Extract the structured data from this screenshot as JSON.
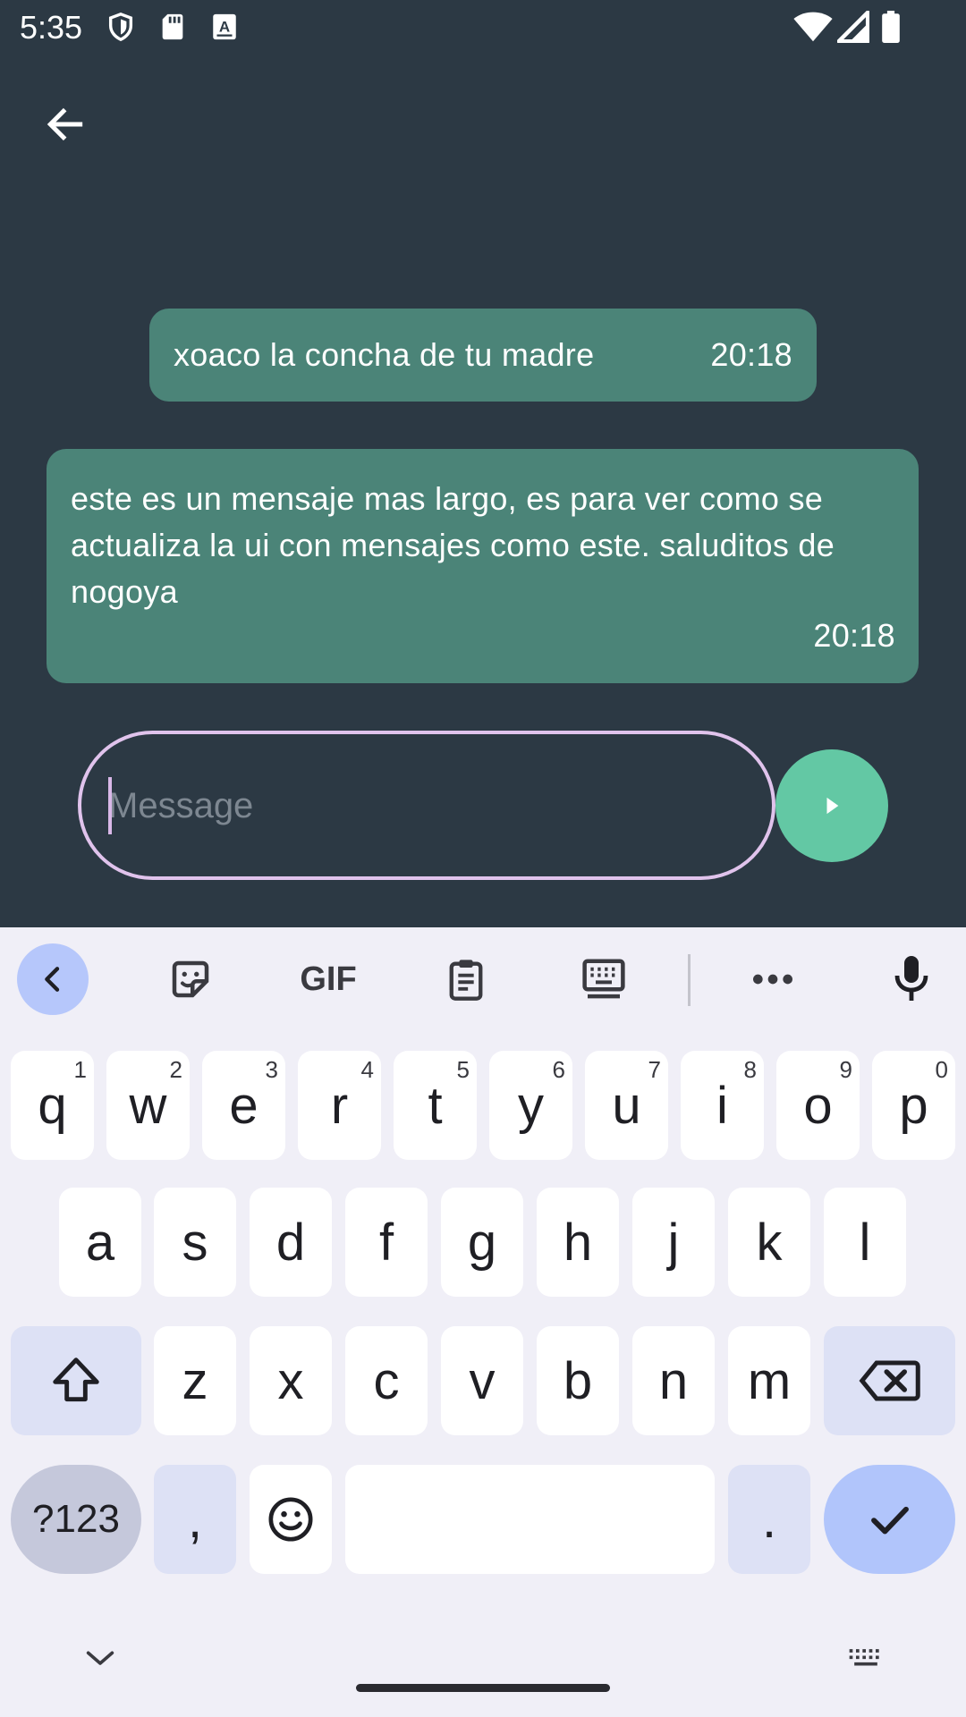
{
  "status_bar": {
    "time": "5:35",
    "icons_left": [
      "shield-icon",
      "sd-card-icon",
      "keyboard-a-icon"
    ],
    "icons_right": [
      "wifi-icon",
      "signal-icon",
      "battery-icon"
    ]
  },
  "app_bar": {
    "back_icon": "arrow-left-icon"
  },
  "messages": [
    {
      "text": "xoaco la concha de tu madre",
      "time": "20:18"
    },
    {
      "text": "este es un mensaje mas largo, es para ver como se actualiza la ui con mensajes como este. saluditos de nogoya",
      "time": "20:18"
    }
  ],
  "composer": {
    "placeholder": "Message",
    "value": "",
    "send_icon": "send-icon"
  },
  "colors": {
    "background": "#2c3944",
    "bubble": "#4b8478",
    "composer_border": "#e0c3ec",
    "send_button": "#63c8a4",
    "keyboard_bg": "#f0eff7",
    "key_accent": "#b1c5fb"
  },
  "keyboard": {
    "toolbar": [
      "chevron-left-icon",
      "sticker-icon",
      "gif-icon",
      "clipboard-icon",
      "keyboard-settings-icon",
      "more-icon",
      "microphone-icon"
    ],
    "gif_label": "GIF",
    "row1": [
      {
        "label": "q",
        "hint": "1"
      },
      {
        "label": "w",
        "hint": "2"
      },
      {
        "label": "e",
        "hint": "3"
      },
      {
        "label": "r",
        "hint": "4"
      },
      {
        "label": "t",
        "hint": "5"
      },
      {
        "label": "y",
        "hint": "6"
      },
      {
        "label": "u",
        "hint": "7"
      },
      {
        "label": "i",
        "hint": "8"
      },
      {
        "label": "o",
        "hint": "9"
      },
      {
        "label": "p",
        "hint": "0"
      }
    ],
    "row2": [
      "a",
      "s",
      "d",
      "f",
      "g",
      "h",
      "j",
      "k",
      "l"
    ],
    "row3": [
      "z",
      "x",
      "c",
      "v",
      "b",
      "n",
      "m"
    ],
    "symbols_label": "?123",
    "comma_label": ",",
    "period_label": "."
  }
}
